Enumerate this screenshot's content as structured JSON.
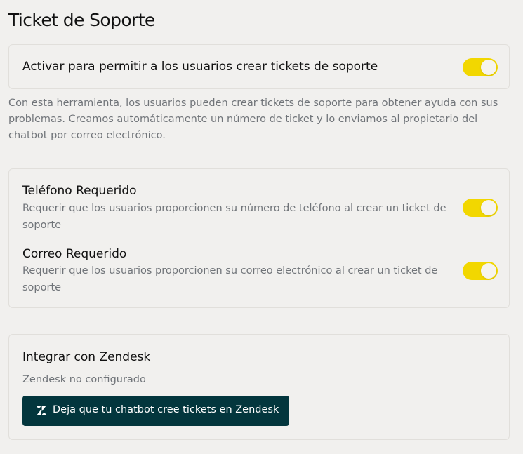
{
  "page": {
    "title": "Ticket de Soporte"
  },
  "activate": {
    "label": "Activar para permitir a los usuarios crear tickets de soporte",
    "enabled": true
  },
  "description": "Con esta herramienta, los usuarios pueden crear tickets de soporte para obtener ayuda con sus problemas. Creamos automáticamente un número de ticket y lo enviamos al propietario del chatbot por correo electrónico.",
  "settings": {
    "phone": {
      "title": "Teléfono Requerido",
      "description": "Requerir que los usuarios proporcionen su número de teléfono al crear un ticket de soporte",
      "enabled": true
    },
    "email": {
      "title": "Correo Requerido",
      "description": "Requerir que los usuarios proporcionen su correo electrónico al crear un ticket de soporte",
      "enabled": true
    }
  },
  "zendesk": {
    "title": "Integrar con Zendesk",
    "status": "Zendesk no configurado",
    "button_label": "Deja que tu chatbot cree tickets en Zendesk",
    "button_icon": "zendesk-logo-icon"
  },
  "colors": {
    "background": "#f1f0ee",
    "toggle_on": "#f2d700",
    "zendesk_button": "#03363d",
    "muted_text": "#707479"
  }
}
